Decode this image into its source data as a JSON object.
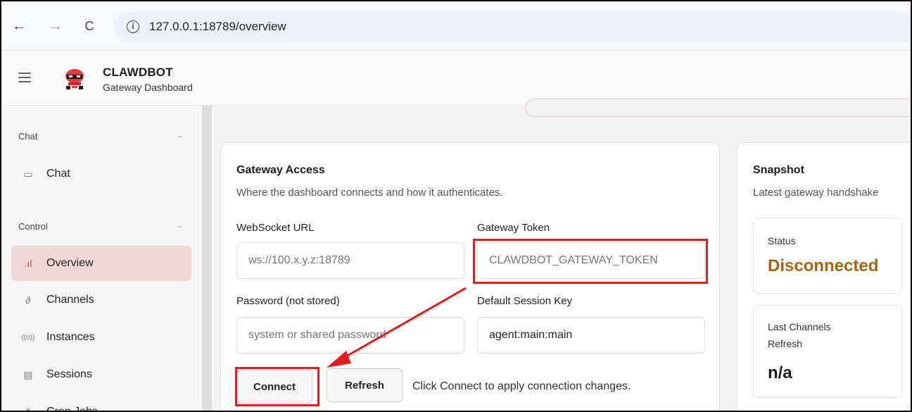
{
  "browser": {
    "url": "127.0.0.1:18789/overview",
    "back_glyph": "←",
    "forward_glyph": "→",
    "reload_glyph": "C",
    "info_glyph": "i"
  },
  "app": {
    "title": "CLAWDBOT",
    "subtitle": "Gateway Dashboard"
  },
  "sidebar": {
    "sections": [
      {
        "label": "Chat",
        "collapse": "–"
      },
      {
        "label": "Control",
        "collapse": "–"
      }
    ],
    "items": [
      {
        "label": "Chat",
        "icon": "chat-icon",
        "glyph": "▭"
      },
      {
        "label": "Overview",
        "icon": "bar-chart-icon",
        "glyph": ".ıl"
      },
      {
        "label": "Channels",
        "icon": "link-icon",
        "glyph": "∂"
      },
      {
        "label": "Instances",
        "icon": "broadcast-icon",
        "glyph": "((o))"
      },
      {
        "label": "Sessions",
        "icon": "document-icon",
        "glyph": "▤"
      },
      {
        "label": "Cron Jobs",
        "icon": "loader-icon",
        "glyph": "⁂"
      }
    ]
  },
  "gateway_access": {
    "title": "Gateway Access",
    "subtitle": "Where the dashboard connects and how it authenticates.",
    "websocket_label": "WebSocket URL",
    "websocket_placeholder": "ws://100.x.y.z:18789",
    "token_label": "Gateway Token",
    "token_placeholder": "CLAWDBOT_GATEWAY_TOKEN",
    "password_label": "Password (not stored)",
    "password_placeholder": "system or shared password",
    "session_label": "Default Session Key",
    "session_value": "agent:main:main",
    "connect_label": "Connect",
    "refresh_label": "Refresh",
    "hint": "Click Connect to apply connection changes."
  },
  "snapshot": {
    "title": "Snapshot",
    "subtitle": "Latest gateway handshake",
    "status_label": "Status",
    "status_value": "Disconnected",
    "status_color": "#a86412",
    "last_refresh_label_1": "Last Channels",
    "last_refresh_label_2": "Refresh",
    "last_refresh_value": "n/a"
  },
  "colors": {
    "accent_active": "#f0d6d6",
    "annotation_red": "#e51c1c"
  }
}
